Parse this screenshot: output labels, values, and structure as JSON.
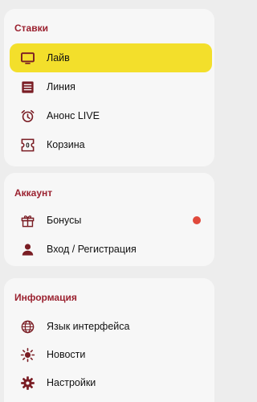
{
  "colors": {
    "accent": "#9b2230",
    "active_bg": "#f3df2b",
    "badge": "#e0493c"
  },
  "bets": {
    "title": "Ставки",
    "items": [
      {
        "label": "Лайв",
        "icon": "tv-icon",
        "active": true
      },
      {
        "label": "Линия",
        "icon": "list-icon"
      },
      {
        "label": "Анонс LIVE",
        "icon": "alarm-clock-icon"
      },
      {
        "label": "Корзина",
        "icon": "coupon-icon",
        "count": "0"
      }
    ]
  },
  "account": {
    "title": "Аккаунт",
    "items": [
      {
        "label": "Бонусы",
        "icon": "gift-icon",
        "has_notification": true
      },
      {
        "label": "Вход / Регистрация",
        "icon": "person-icon"
      }
    ]
  },
  "info": {
    "title": "Информация",
    "items": [
      {
        "label": "Язык интерфейса",
        "icon": "globe-icon"
      },
      {
        "label": "Новости",
        "icon": "sun-icon"
      },
      {
        "label": "Настройки",
        "icon": "gear-icon"
      }
    ]
  }
}
